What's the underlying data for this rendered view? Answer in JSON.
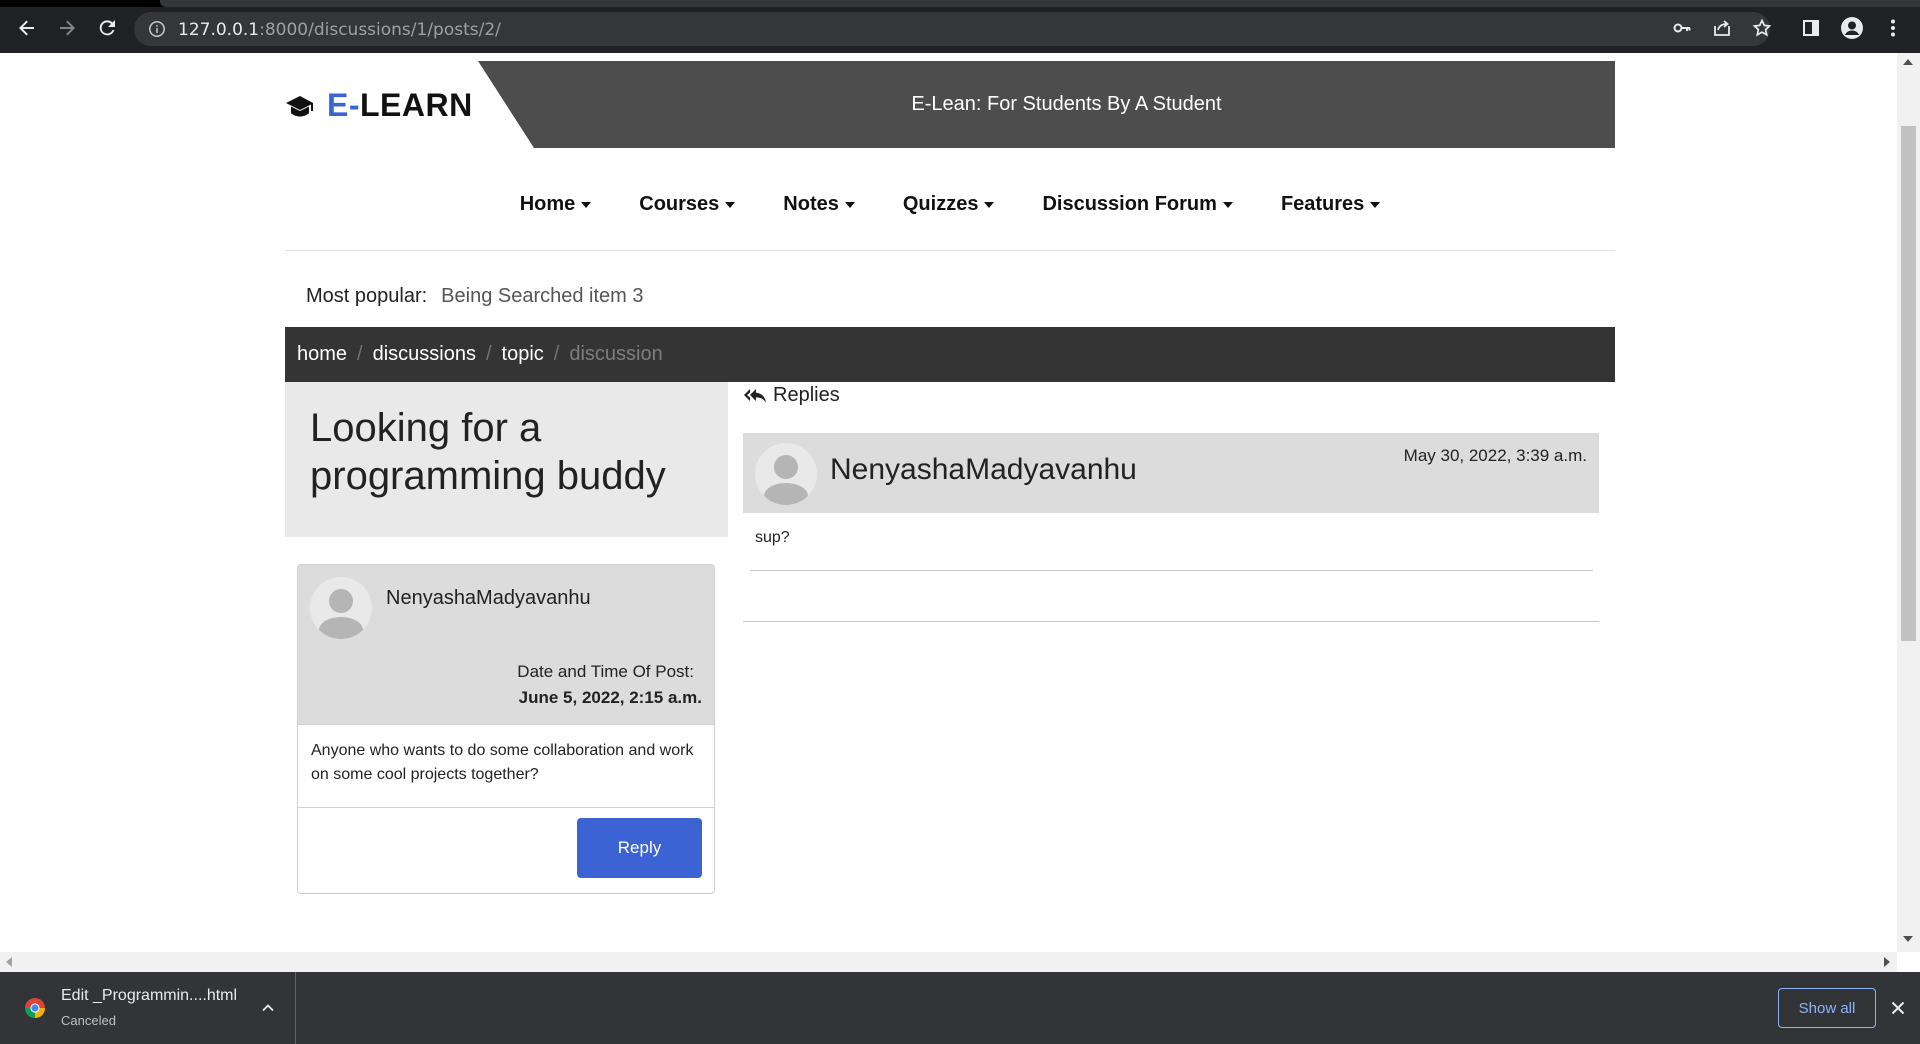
{
  "browser": {
    "url_host": "127.0.0.1",
    "url_path": ":8000/discussions/1/posts/2/"
  },
  "header": {
    "logo_prefix": "E-",
    "logo_main": "LEARN",
    "tagline": "E-Lean: For Students By A Student"
  },
  "menu": {
    "items": [
      {
        "label": "Home"
      },
      {
        "label": "Courses"
      },
      {
        "label": "Notes"
      },
      {
        "label": "Quizzes"
      },
      {
        "label": "Discussion Forum"
      },
      {
        "label": "Features"
      }
    ]
  },
  "popular": {
    "label": "Most popular:",
    "item": "Being Searched item 3"
  },
  "breadcrumb": {
    "items": [
      "home",
      "discussions",
      "topic"
    ],
    "separator": "/",
    "active": "discussion"
  },
  "post": {
    "title": "Looking for a programming buddy",
    "author": "NenyashaMadyavanhu",
    "date_label": "Date and Time Of Post:",
    "date_value": "June 5, 2022, 2:15 a.m.",
    "body": "Anyone who wants to do some collaboration and work on some cool projects together?",
    "reply_label": "Reply"
  },
  "replies": {
    "heading": "Replies",
    "items": [
      {
        "author": "NenyashaMadyavanhu",
        "date": "May 30, 2022, 3:39 a.m.",
        "body": "sup?"
      }
    ]
  },
  "downloads": {
    "file_name": "Edit _Programmin....html",
    "status": "Canceled",
    "show_all_label": "Show all"
  },
  "colors": {
    "accent": "#3c63d4",
    "banner": "#4d4d4d",
    "breadcrumb_bg": "#343434"
  }
}
